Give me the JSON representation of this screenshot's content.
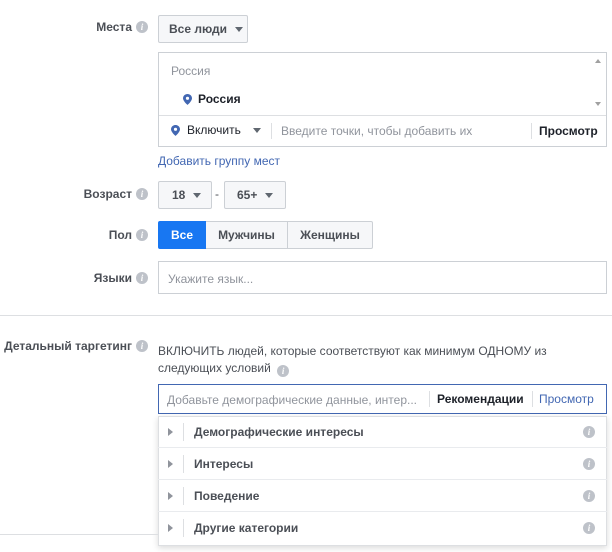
{
  "locations": {
    "label": "Места",
    "audience_select": "Все люди",
    "list_header": "Россия",
    "selected_location": "Россия",
    "include_select": "Включить",
    "input_placeholder": "Введите точки, чтобы добавить их",
    "browse": "Просмотр",
    "add_group": "Добавить группу мест"
  },
  "age": {
    "label": "Возраст",
    "min": "18",
    "dash": "-",
    "max": "65+"
  },
  "gender": {
    "label": "Пол",
    "options": [
      "Все",
      "Мужчины",
      "Женщины"
    ],
    "selected": "Все"
  },
  "languages": {
    "label": "Языки",
    "placeholder": "Укажите язык..."
  },
  "detailed_targeting": {
    "label": "Детальный таргетинг",
    "description": "ВКЛЮЧИТЬ людей, которые соответствуют как минимум ОДНОМУ из следующих условий",
    "input_placeholder": "Добавьте демографические данные, интер...",
    "suggestions": "Рекомендации",
    "browse": "Просмотр",
    "categories": [
      "Демографические интересы",
      "Интересы",
      "Поведение",
      "Другие категории"
    ]
  },
  "colors": {
    "accent": "#4267b2",
    "selected_toggle": "#1877f2",
    "label_gray": "#4b4f56",
    "border": "#ccd0d5"
  }
}
